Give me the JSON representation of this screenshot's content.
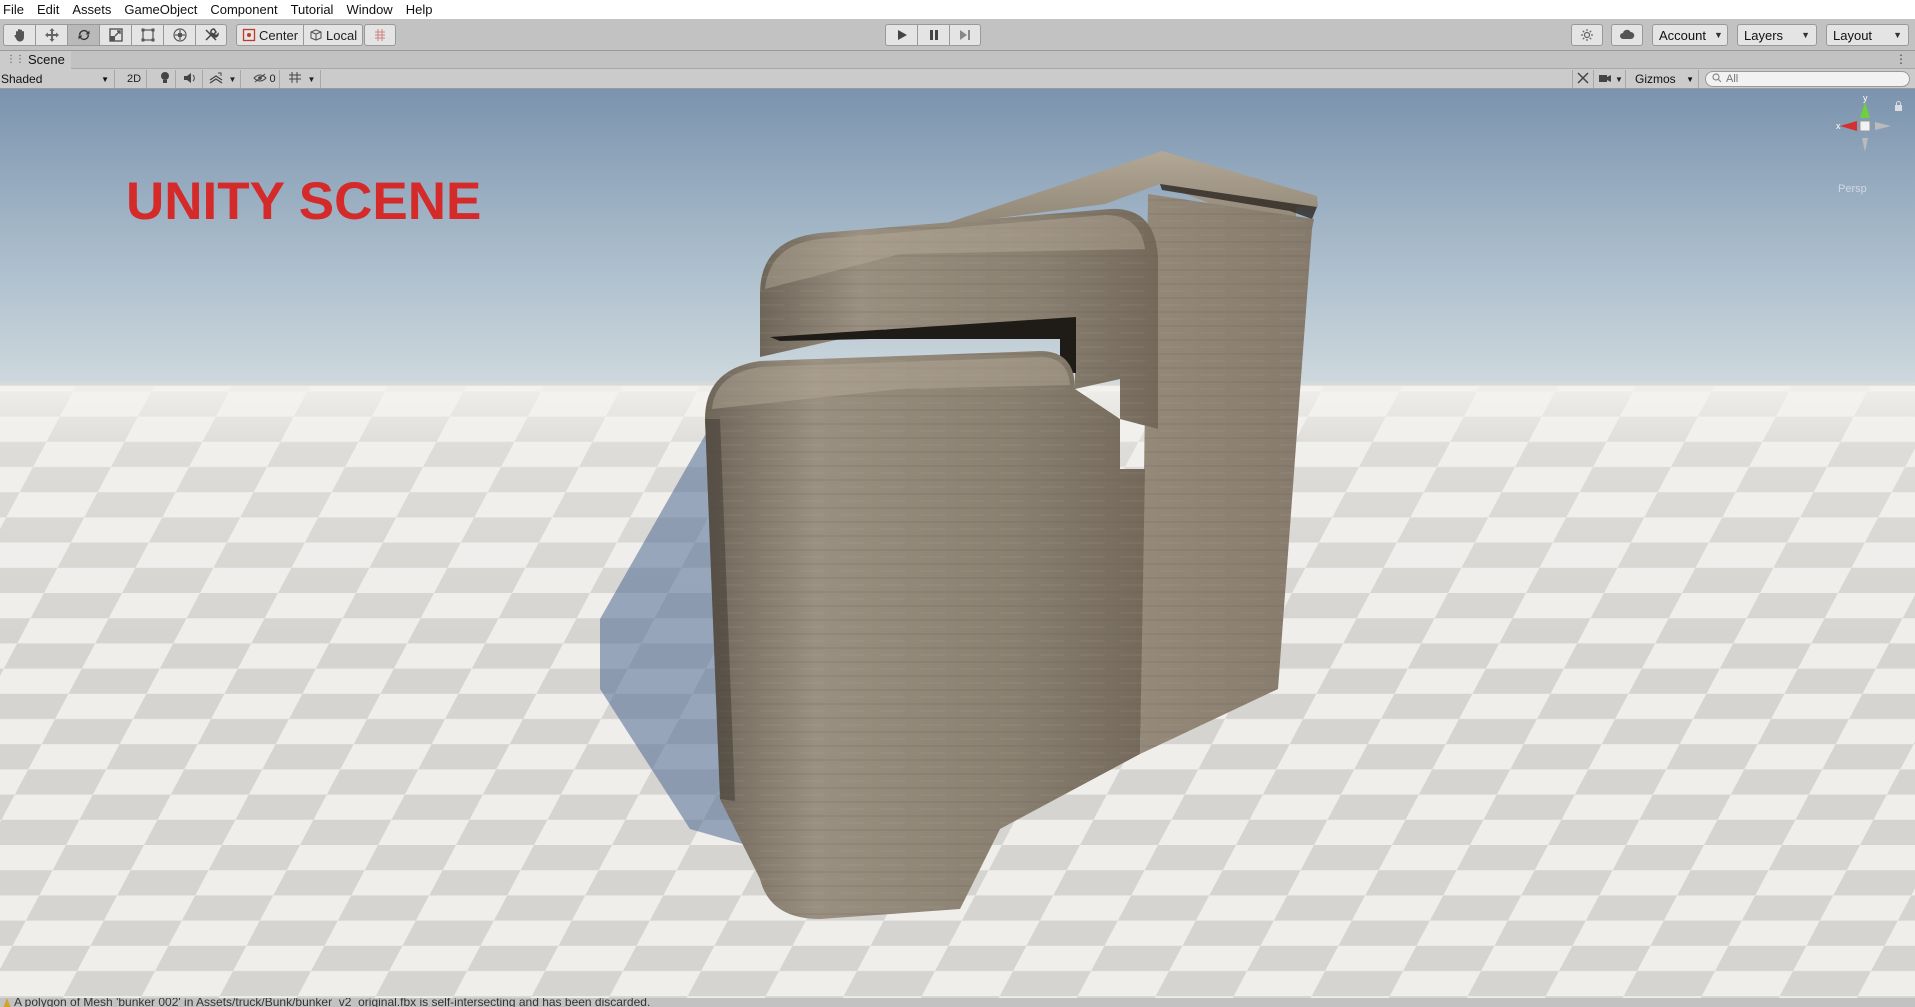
{
  "menu": [
    "File",
    "Edit",
    "Assets",
    "GameObject",
    "Component",
    "Tutorial",
    "Window",
    "Help"
  ],
  "toolbar": {
    "tools": [
      {
        "name": "hand-tool",
        "icon": "hand-icon"
      },
      {
        "name": "move-tool",
        "icon": "move-arrows-icon"
      },
      {
        "name": "rotate-tool",
        "icon": "rotate-icon"
      },
      {
        "name": "scale-tool",
        "icon": "scale-icon"
      },
      {
        "name": "rect-tool",
        "icon": "rect-icon"
      },
      {
        "name": "transform-tool",
        "icon": "transform-icon"
      },
      {
        "name": "custom-tool",
        "icon": "custom-tools-icon"
      }
    ],
    "active_tool": "rotate-tool",
    "pivot_label": "Center",
    "space_label": "Local",
    "account_label": "Account",
    "layers_label": "Layers",
    "layout_label": "Layout"
  },
  "tab": {
    "title": "Scene"
  },
  "scene_toolbar": {
    "shading_mode": "Shaded",
    "mode_2d": "2D",
    "hidden_count": "0",
    "gizmos_label": "Gizmos",
    "search_placeholder": "All"
  },
  "viewport": {
    "overlay_title": "UNITY SCENE",
    "projection_label": "Persp",
    "axis_x_label": "x",
    "axis_y_label": "y"
  },
  "status": {
    "message": "A polygon of Mesh 'bunker 002' in Assets/truck/Bunk/bunker_v2_original.fbx is self-intersecting and has been discarded."
  },
  "colors": {
    "overlay_title": "#d42a2a",
    "sky_top": "#7d95b0",
    "sky_horizon": "#c9d6de",
    "floor_light": "#ededea",
    "floor_dark": "#d3d1cd",
    "concrete": "#8e8476"
  }
}
